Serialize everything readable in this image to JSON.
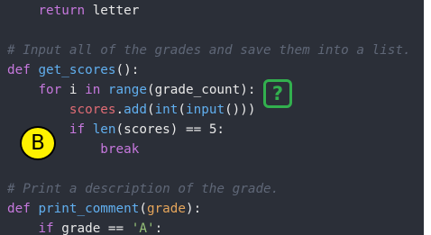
{
  "code": {
    "line_return": {
      "indent": "    ",
      "keyword": "return",
      "rest": " letter"
    },
    "comment_1": "# Input all of the grades and save them into a list.",
    "line_def_get_scores": {
      "keyword": "def",
      "space": " ",
      "name": "get_scores",
      "rest": "():"
    },
    "line_for": {
      "indent": "    ",
      "kw_for": "for",
      "mid": " i ",
      "kw_in": "in",
      "space": " ",
      "range_fn": "range",
      "rest": "(grade_count):"
    },
    "line_add": {
      "indent": "        ",
      "obj": "scores",
      "dot": ".",
      "method": "add",
      "paren1": "(",
      "int_fn": "int",
      "paren2": "(",
      "input_fn": "input",
      "rest": "()))"
    },
    "line_if_len": {
      "indent": "        ",
      "kw_if": "if",
      "space": " ",
      "len_fn": "len",
      "rest": "(scores) == 5:"
    },
    "line_break": {
      "indent": "            ",
      "keyword": "break"
    },
    "comment_2": "# Print a description of the grade.",
    "line_def_print": {
      "keyword": "def",
      "space": " ",
      "name": "print_comment",
      "paren_open": "(",
      "param": "grade",
      "rest": "):"
    },
    "line_if_grade": {
      "indent": "    ",
      "kw_if": "if",
      "mid": " grade == ",
      "str": "'A'",
      "rest": ":"
    }
  },
  "badges": {
    "question": "?",
    "b_label": "B"
  },
  "colors": {
    "background": "#2b2f38",
    "keyword": "#c678dd",
    "function": "#61afef",
    "comment": "#5f6777",
    "param": "#e5a55b",
    "badge_green": "#32b04e",
    "badge_yellow": "#fff200"
  }
}
